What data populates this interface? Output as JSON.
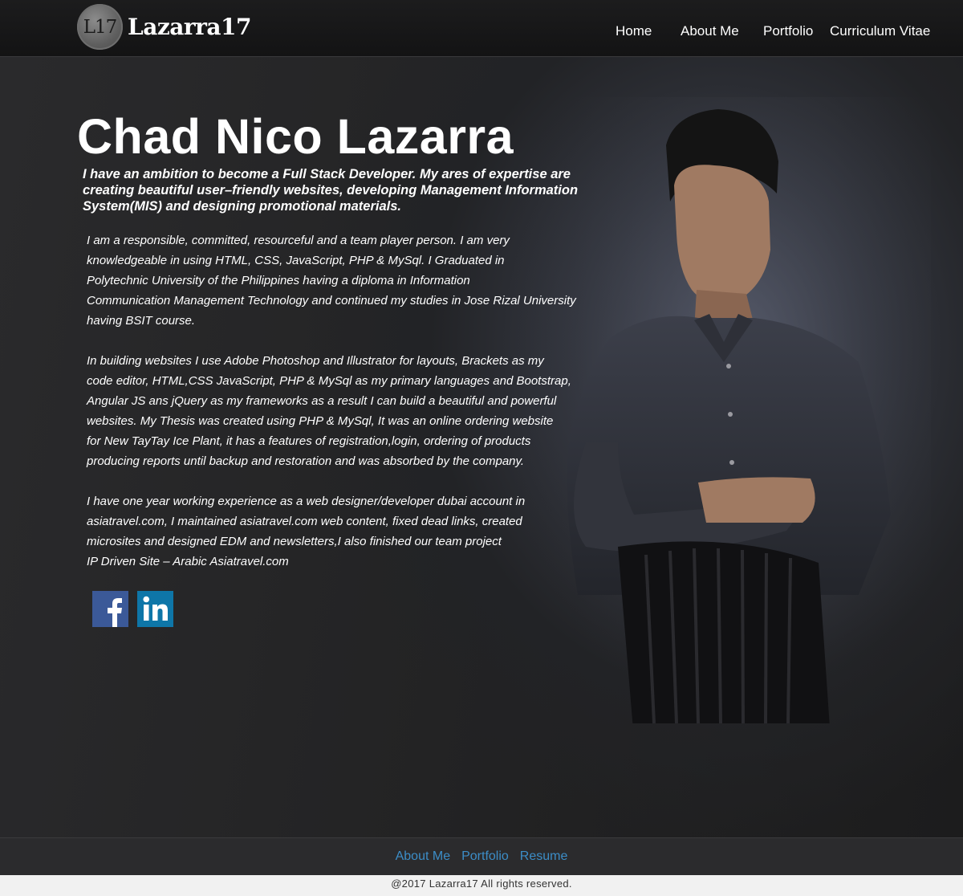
{
  "header": {
    "logo_badge": "L17",
    "logo_text": "Lazarra17",
    "nav": [
      {
        "label": "Home"
      },
      {
        "label": "About Me"
      },
      {
        "label": "Portfolio"
      },
      {
        "label": "Curriculum Vitae"
      }
    ]
  },
  "hero": {
    "name": "Chad Nico Lazarra",
    "tagline": "I have an ambition to become a Full Stack Developer.  My ares of expertise are creating beautiful user–friendly websites, developing Management Information System(MIS) and designing promotional materials.",
    "paragraphs": [
      "I am a responsible, committed, resourceful and a team player person. I am very\nknowledgeable in using HTML, CSS, JavaScript, PHP & MySql.  I Graduated in\nPolytechnic University of the Philippines having a diploma in Information\nCommunication Management Technology and continued my studies in Jose Rizal University\nhaving BSIT course.",
      "In building websites I use Adobe Photoshop and Illustrator for layouts, Brackets as my\ncode editor, HTML,CSS JavaScript, PHP & MySql as my primary languages and Bootstrap,\nAngular JS ans jQuery as my frameworks as a result I can build a beautiful and powerful\nwebsites.  My Thesis was created using PHP & MySql, It was an online ordering website\nfor New TayTay Ice Plant, it has a features of registration,login, ordering of products\nproducing reports until backup and restoration and was absorbed by the company.",
      "I have one year working experience as a web designer/developer dubai account in\nasiatravel.com, I maintained asiatravel.com web content, fixed dead links, created\nmicrosites and designed EDM and newsletters,I also finished our team project\nIP Driven Site – Arabic Asiatravel.com"
    ],
    "socials": [
      {
        "icon": "facebook-icon",
        "color": "#3b5998"
      },
      {
        "icon": "linkedin-icon",
        "color": "#0e76a8"
      }
    ]
  },
  "footer": {
    "links": [
      {
        "label": "About Me"
      },
      {
        "label": "Portfolio"
      },
      {
        "label": "Resume"
      }
    ],
    "copyright": "@2017 Lazarra17 All rights  reserved."
  },
  "colors": {
    "header_bg": "#161617",
    "hero_bg": "#232324",
    "footer_link": "#3c8dc7",
    "copyright_bg": "#f1f1f1"
  }
}
